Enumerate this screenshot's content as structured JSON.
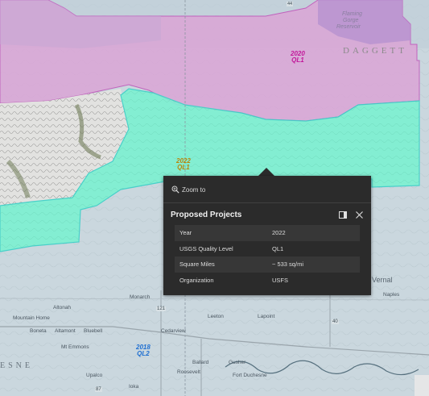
{
  "map_labels": {
    "daggett": "DAGGETT",
    "flaming": "Flaming",
    "gorge": "Gorge",
    "reservoir": "Reservoir",
    "vernal": "Vernal",
    "naples": "Naples",
    "monarch": "Monarch",
    "altonah": "Altonah",
    "mountain_home": "Mountain Home",
    "boneta": "Boneta",
    "altamont": "Altamont",
    "bluebell": "Bluebell",
    "mt_emmons": "Mt Emmons",
    "cedarview": "Cedarview",
    "leeton": "Leeton",
    "lapoint": "Lapoint",
    "ballard": "Ballard",
    "gusher": "Gusher",
    "roosevelt": "Roosevelt",
    "fort_duchesne": "Fort Duchesne",
    "upalco": "Upalco",
    "ioka": "Ioka",
    "duchesne_fragment": "ESNE",
    "route_121": "121",
    "route_40": "40",
    "route_87": "87",
    "route_44": "44"
  },
  "projects": [
    {
      "year": "2020",
      "level": "QL1",
      "color": "#c2189a"
    },
    {
      "year": "2022",
      "level": "QL1",
      "color": "#b8860b"
    },
    {
      "year": "2018",
      "level": "QL2",
      "color": "#1f6fd1"
    }
  ],
  "popup": {
    "zoom_label": "Zoom to",
    "title": "Proposed Projects",
    "rows": [
      {
        "key": "Year",
        "value": "2022"
      },
      {
        "key": "USGS Quality Level",
        "value": "QL1"
      },
      {
        "key": "Square Miles",
        "value": "~ 533 sq/mi"
      },
      {
        "key": "Organization",
        "value": "USFS"
      }
    ]
  },
  "colors": {
    "teal_area": "#7ef0d2",
    "pink_area": "#e3a3d9",
    "purple_area": "#c59ad8",
    "popup_bg": "#2b2b2b"
  }
}
